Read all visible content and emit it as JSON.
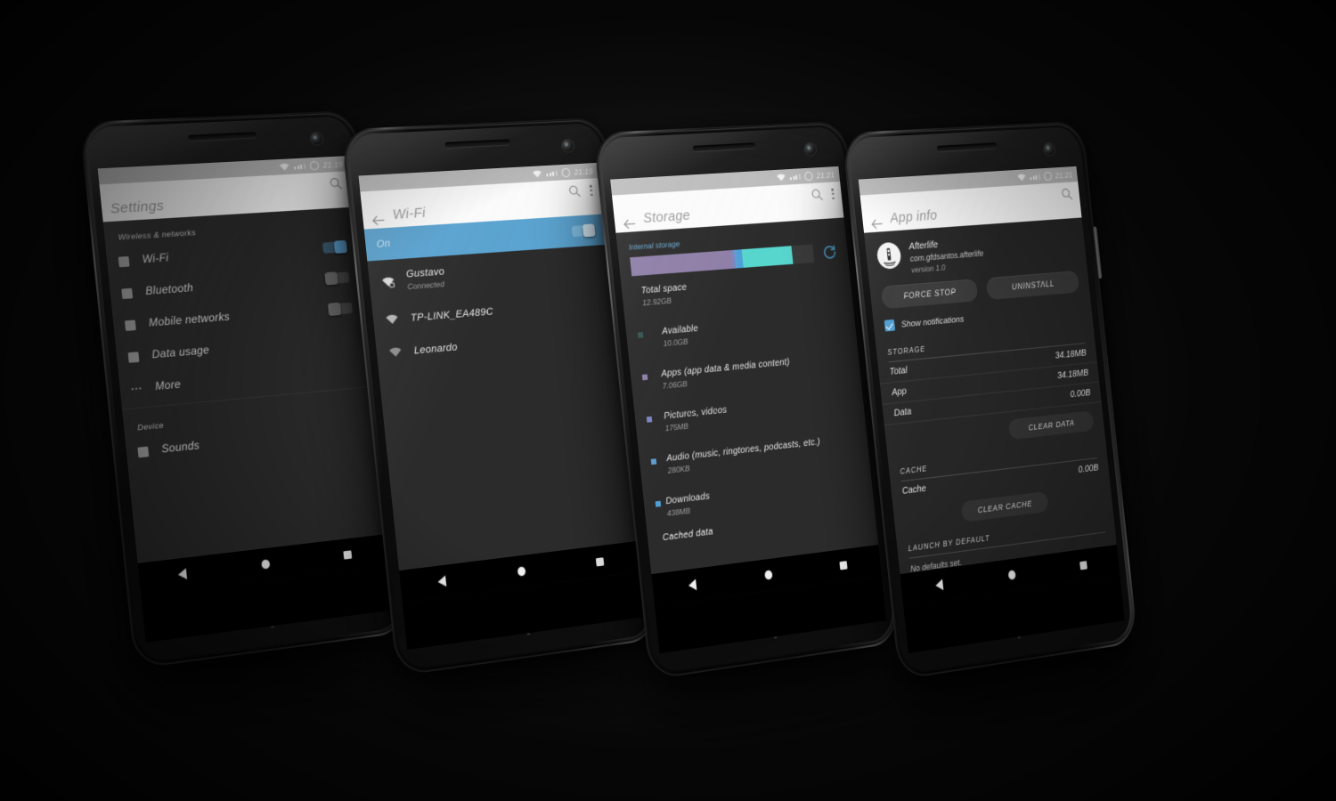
{
  "scene": {
    "title": "Android dark theme showcase — four device screens",
    "background_color": "#0a0a0a",
    "accent_color": "#5ba3d0"
  },
  "phones": [
    {
      "id": "phone-settings",
      "screen": "Settings",
      "statusbar": {
        "time": "21:19",
        "wifi_icon": "wifi-icon",
        "signal_icon": "signal-icon",
        "battery_icon": "battery-circle-icon"
      },
      "actionbar": {
        "title": "Settings",
        "has_back": false,
        "search_icon": "search-icon",
        "overflow_icon": "overflow-menu-icon",
        "show_overflow": false
      },
      "sections": [
        {
          "header": "Wireless & networks",
          "items": [
            {
              "icon": "wifi-settings-icon",
              "label": "Wi-Fi",
              "toggle": "on"
            },
            {
              "icon": "bluetooth-icon",
              "label": "Bluetooth",
              "toggle": "off"
            },
            {
              "icon": "mobile-network-icon",
              "label": "Mobile networks",
              "toggle": "off"
            },
            {
              "icon": "data-usage-icon",
              "label": "Data usage",
              "toggle": "none"
            },
            {
              "icon": "more-dots-icon",
              "label": "More",
              "toggle": "none"
            }
          ]
        },
        {
          "header": "Device",
          "items": [
            {
              "icon": "sounds-icon",
              "label": "Sounds",
              "toggle": "none"
            }
          ]
        }
      ],
      "navbar": {
        "back": "back-triangle-icon",
        "home": "home-circle-icon",
        "recents": "recents-square-icon"
      }
    },
    {
      "id": "phone-wifi",
      "screen": "Wi-Fi",
      "statusbar": {
        "time": "21:19",
        "wifi_icon": "wifi-icon",
        "signal_icon": "signal-icon",
        "battery_icon": "battery-circle-icon"
      },
      "actionbar": {
        "title": "Wi-Fi",
        "has_back": true,
        "back_icon": "back-arrow-icon",
        "search_icon": "search-icon",
        "overflow_icon": "overflow-menu-icon",
        "show_overflow": true
      },
      "master_switch": {
        "label": "On",
        "state": "on",
        "bar_color": "#5ba3d0"
      },
      "networks": [
        {
          "icon": "wifi-locked-icon",
          "name": "Gustavo",
          "status": "Connected",
          "strength": 3
        },
        {
          "icon": "wifi-locked-icon",
          "name": "TP-LINK_EA489C",
          "status": "",
          "strength": 2
        },
        {
          "icon": "wifi-open-icon",
          "name": "Leonardo",
          "status": "",
          "strength": 1
        }
      ],
      "navbar": {
        "back": "back-triangle-icon",
        "home": "home-circle-icon",
        "recents": "recents-square-icon"
      }
    },
    {
      "id": "phone-storage",
      "screen": "Storage",
      "statusbar": {
        "time": "21:21",
        "wifi_icon": "wifi-icon",
        "signal_icon": "signal-icon",
        "battery_icon": "battery-circle-icon"
      },
      "actionbar": {
        "title": "Storage",
        "has_back": true,
        "back_icon": "back-arrow-icon",
        "search_icon": "search-icon",
        "overflow_icon": "overflow-menu-icon",
        "show_overflow": true
      },
      "internal_label": "Internal storage",
      "refresh_icon": "refresh-icon",
      "chart_data": {
        "type": "bar",
        "title": "Internal storage",
        "categories": [
          "Apps (app data & media content)",
          "Pictures, videos",
          "Audio (music, ringtones, podcasts, etc.)",
          "Downloads",
          "Cached data",
          "Available"
        ],
        "values": [
          7.06,
          0.175,
          0.00028,
          0.438,
          0.0,
          10.0
        ],
        "value_labels": [
          "7.06GB",
          "175MB",
          "280KB",
          "438MB",
          "",
          "10.0GB"
        ],
        "colors": [
          "#8f7fa8",
          "#7f86c0",
          "#5f9fd0",
          "#4fa0d8",
          "#3f7fb0",
          "#57d6cd"
        ],
        "total": 12.92,
        "total_label": "12.92GB",
        "unit": "GB",
        "track_color": "#3a3a3a",
        "legend": "inline",
        "grid": false
      },
      "rows": [
        {
          "name": "Total space",
          "value": "12.92GB",
          "dot": "none"
        },
        {
          "name": "Available",
          "value": "10.0GB",
          "dot": "#57d6cd"
        },
        {
          "name": "Apps (app data & media content)",
          "value": "7.06GB",
          "dot": "#8f7fa8"
        },
        {
          "name": "Pictures, videos",
          "value": "175MB",
          "dot": "#7f86c0"
        },
        {
          "name": "Audio (music, ringtones, podcasts, etc.)",
          "value": "280KB",
          "dot": "#5f9fd0"
        },
        {
          "name": "Downloads",
          "value": "438MB",
          "dot": "#4fa0d8"
        },
        {
          "name": "Cached data",
          "value": "",
          "dot": "none"
        }
      ],
      "navbar": {
        "back": "back-triangle-icon",
        "home": "home-circle-icon",
        "recents": "recents-square-icon"
      }
    },
    {
      "id": "phone-appinfo",
      "screen": "App info",
      "statusbar": {
        "time": "21:21",
        "wifi_icon": "wifi-icon",
        "signal_icon": "signal-icon",
        "battery_icon": "battery-circle-icon"
      },
      "actionbar": {
        "title": "App info",
        "has_back": true,
        "back_icon": "back-arrow-icon",
        "search_icon": "search-icon",
        "overflow_icon": "overflow-menu-icon",
        "show_overflow": false
      },
      "app": {
        "icon": "afterlife-app-icon",
        "name": "Afterlife",
        "package": "com.gfdsantos.afterlife",
        "version": "version 1.0"
      },
      "buttons": {
        "force_stop": "FORCE STOP",
        "uninstall": "UNINSTALL"
      },
      "notifications": {
        "label": "Show notifications",
        "checked": true
      },
      "storage": {
        "section": "STORAGE",
        "lines": [
          {
            "key": "Total",
            "value": "34.18MB"
          },
          {
            "key": "App",
            "value": "34.18MB"
          },
          {
            "key": "Data",
            "value": "0.00B"
          }
        ],
        "clear_button": "CLEAR DATA"
      },
      "cache": {
        "section": "CACHE",
        "lines": [
          {
            "key": "Cache",
            "value": "0.00B"
          }
        ],
        "clear_button": "CLEAR CACHE"
      },
      "launch": {
        "section": "LAUNCH BY DEFAULT",
        "note": "No defaults set."
      },
      "navbar": {
        "back": "back-triangle-icon",
        "home": "home-circle-icon",
        "recents": "recents-square-icon"
      }
    }
  ]
}
